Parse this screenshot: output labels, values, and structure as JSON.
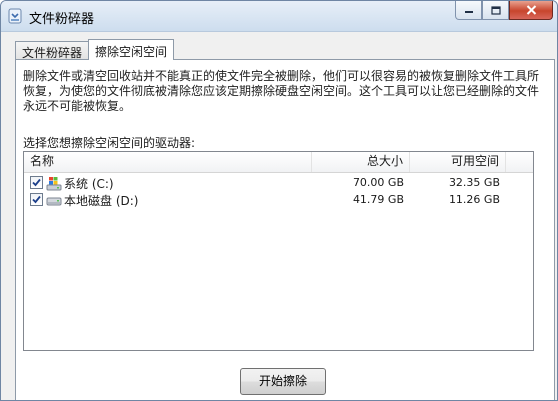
{
  "window": {
    "title": "文件粉碎器",
    "minimize_icon": "minimize-icon",
    "maximize_icon": "maximize-icon",
    "close_icon": "close-icon"
  },
  "tabs": [
    {
      "label": "文件粉碎器",
      "active": false
    },
    {
      "label": "擦除空闲空间",
      "active": true
    }
  ],
  "description": "删除文件或清空回收站并不能真正的使文件完全被删除，他们可以很容易的被恢复删除文件工具所恢复，为使您的文件彻底被清除您应该定期擦除硬盘空闲空间。这个工具可以让您已经删除的文件永远不可能被恢复。",
  "drive_prompt": "选择您想擦除空闲空间的驱动器:",
  "list": {
    "columns": {
      "name": "名称",
      "total": "总大小",
      "free": "可用空间"
    },
    "rows": [
      {
        "name": "系统 (C:)",
        "total": "70.00 GB",
        "free": "32.35 GB",
        "checked": true,
        "icon": "windows-drive-icon"
      },
      {
        "name": "本地磁盘 (D:)",
        "total": "41.79 GB",
        "free": "11.26 GB",
        "checked": true,
        "icon": "hard-drive-icon"
      }
    ]
  },
  "start_button": "开始擦除"
}
